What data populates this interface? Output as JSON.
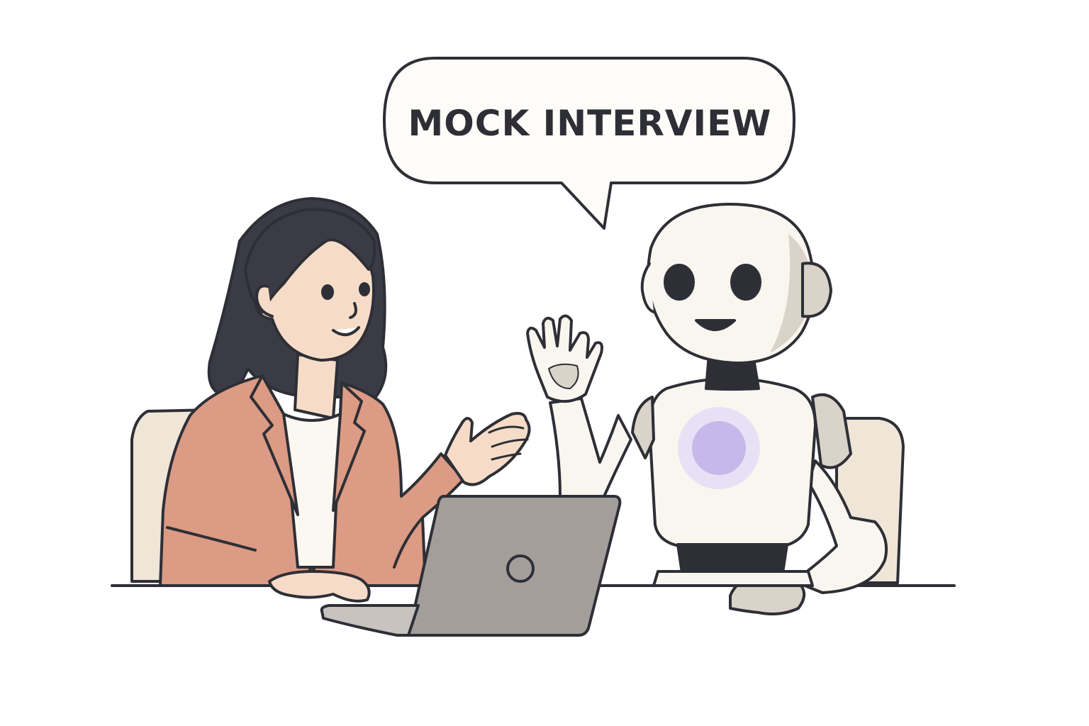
{
  "speech_bubble": {
    "text": "MOCK INTERVIEW"
  },
  "colors": {
    "outline": "#2e2f36",
    "hair": "#3a3b45",
    "skin": "#f6dcc8",
    "blazer": "#dc9b84",
    "shirt": "#fbf8f2",
    "chair": "#efe6d8",
    "laptop": "#a39e9a",
    "robot_body": "#f9f6ef",
    "robot_shade": "#d9d3c9",
    "robot_joint": "#2e2f36",
    "robot_chest_light": "#c8b7ea",
    "bubble_fill": "#fdfcf8"
  },
  "icons": {
    "laptop_logo": "circle-logo-icon",
    "chest_light": "chest-light-icon"
  }
}
